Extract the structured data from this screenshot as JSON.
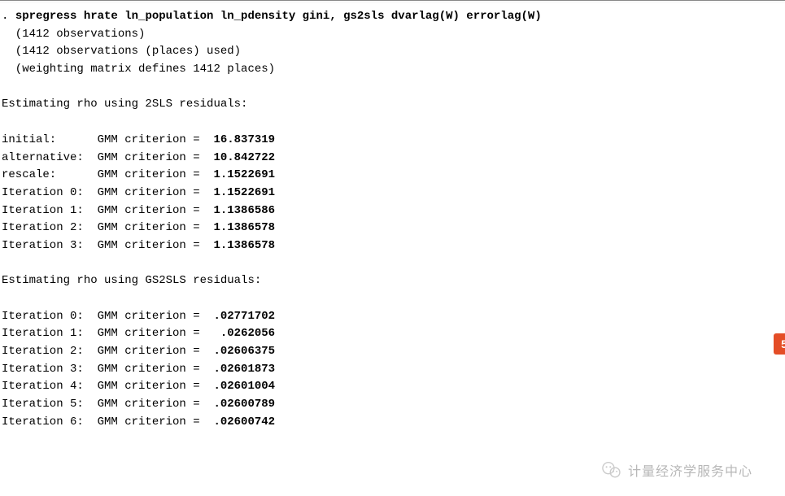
{
  "command": {
    "prompt": ". ",
    "text": "spregress hrate ln_population ln_pdensity gini, gs2sls dvarlag(W) errorlag(W)"
  },
  "info_lines": [
    "  (1412 observations)",
    "  (1412 observations (places) used)",
    "  (weighting matrix defines 1412 places)"
  ],
  "section1_title": "Estimating rho using 2SLS residuals:",
  "section1_rows": [
    {
      "label": "initial:     ",
      "mid": " GMM criterion =  ",
      "value": "16.837319"
    },
    {
      "label": "alternative: ",
      "mid": " GMM criterion =  ",
      "value": "10.842722"
    },
    {
      "label": "rescale:     ",
      "mid": " GMM criterion =  ",
      "value": "1.1522691"
    },
    {
      "label": "Iteration 0: ",
      "mid": " GMM criterion =  ",
      "value": "1.1522691"
    },
    {
      "label": "Iteration 1: ",
      "mid": " GMM criterion =  ",
      "value": "1.1386586"
    },
    {
      "label": "Iteration 2: ",
      "mid": " GMM criterion =  ",
      "value": "1.1386578"
    },
    {
      "label": "Iteration 3: ",
      "mid": " GMM criterion =  ",
      "value": "1.1386578"
    }
  ],
  "section2_title": "Estimating rho using GS2SLS residuals:",
  "section2_rows": [
    {
      "label": "Iteration 0: ",
      "mid": " GMM criterion =  ",
      "value": ".02771702"
    },
    {
      "label": "Iteration 1: ",
      "mid": " GMM criterion =   ",
      "value": ".0262056"
    },
    {
      "label": "Iteration 2: ",
      "mid": " GMM criterion =  ",
      "value": ".02606375"
    },
    {
      "label": "Iteration 3: ",
      "mid": " GMM criterion =  ",
      "value": ".02601873"
    },
    {
      "label": "Iteration 4: ",
      "mid": " GMM criterion =  ",
      "value": ".02601004"
    },
    {
      "label": "Iteration 5: ",
      "mid": " GMM criterion =  ",
      "value": ".02600789"
    },
    {
      "label": "Iteration 6: ",
      "mid": " GMM criterion =  ",
      "value": ".02600742"
    }
  ],
  "watermark_text": "计量经济学服务中心"
}
